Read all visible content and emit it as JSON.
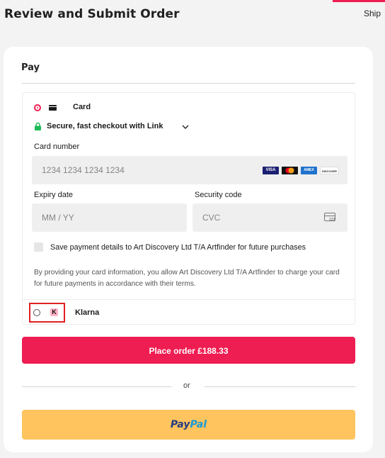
{
  "header": {
    "title": "Review and Submit Order",
    "ship_link": "Ship"
  },
  "pay": {
    "heading": "Pay",
    "card_option": {
      "label": "Card",
      "selected": true
    },
    "link_text": "Secure, fast checkout with Link",
    "card_number": {
      "label": "Card number",
      "placeholder": "1234 1234 1234 1234"
    },
    "card_brands": [
      "VISA",
      "Mastercard",
      "AMEX",
      "DISCOVER"
    ],
    "expiry": {
      "label": "Expiry date",
      "placeholder": "MM / YY"
    },
    "security": {
      "label": "Security code",
      "placeholder": "CVC",
      "icon_text": "123"
    },
    "save_label": "Save payment details to Art Discovery Ltd T/A Artfinder for future purchases",
    "disclaimer": "By providing your card information, you allow Art Discovery Ltd T/A Artfinder to charge your card for future payments in accordance with their terms.",
    "klarna_option": {
      "label": "Klarna",
      "logo_letter": "K",
      "selected": false
    }
  },
  "place_order_label": "Place order £188.33",
  "divider_text": "or",
  "paypal": {
    "pay": "Pay",
    "pal": "Pal"
  },
  "colors": {
    "accent": "#ee1d52",
    "paypal_button": "#ffc45e",
    "highlight_box": "#e02020"
  }
}
